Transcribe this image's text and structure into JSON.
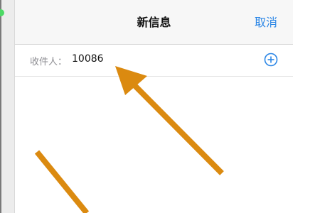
{
  "header": {
    "title": "新信息",
    "cancel_label": "取消"
  },
  "recipient": {
    "label": "收件人：",
    "value": "10086"
  },
  "icons": {
    "add": "plus-circle-icon"
  },
  "colors": {
    "accent": "#2b86e6",
    "arrow": "#db8a10",
    "navbar_bg": "#f7f7f7"
  }
}
